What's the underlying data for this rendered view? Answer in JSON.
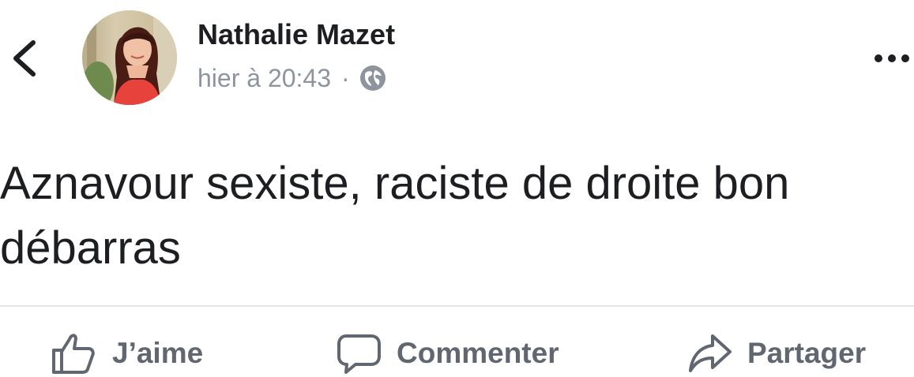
{
  "post": {
    "author": "Nathalie Mazet",
    "timestamp": "hier à 20:43",
    "separator": "·",
    "privacy_icon": "globe-icon",
    "text_lines": [
      "Aznavour sexiste, raciste de droite bon",
      "débarras"
    ]
  },
  "actions": {
    "like_label": "J’aime",
    "comment_label": "Commenter",
    "share_label": "Partager"
  },
  "icons": {
    "back": "chevron-left-icon",
    "more": "more-dots-icon",
    "like": "thumbs-up-icon",
    "comment": "comment-bubble-icon",
    "share": "share-arrow-icon"
  },
  "colors": {
    "text_primary": "#1c1e21",
    "text_secondary": "#8d949e",
    "action_gray": "#606770",
    "divider": "#e4e6eb"
  }
}
